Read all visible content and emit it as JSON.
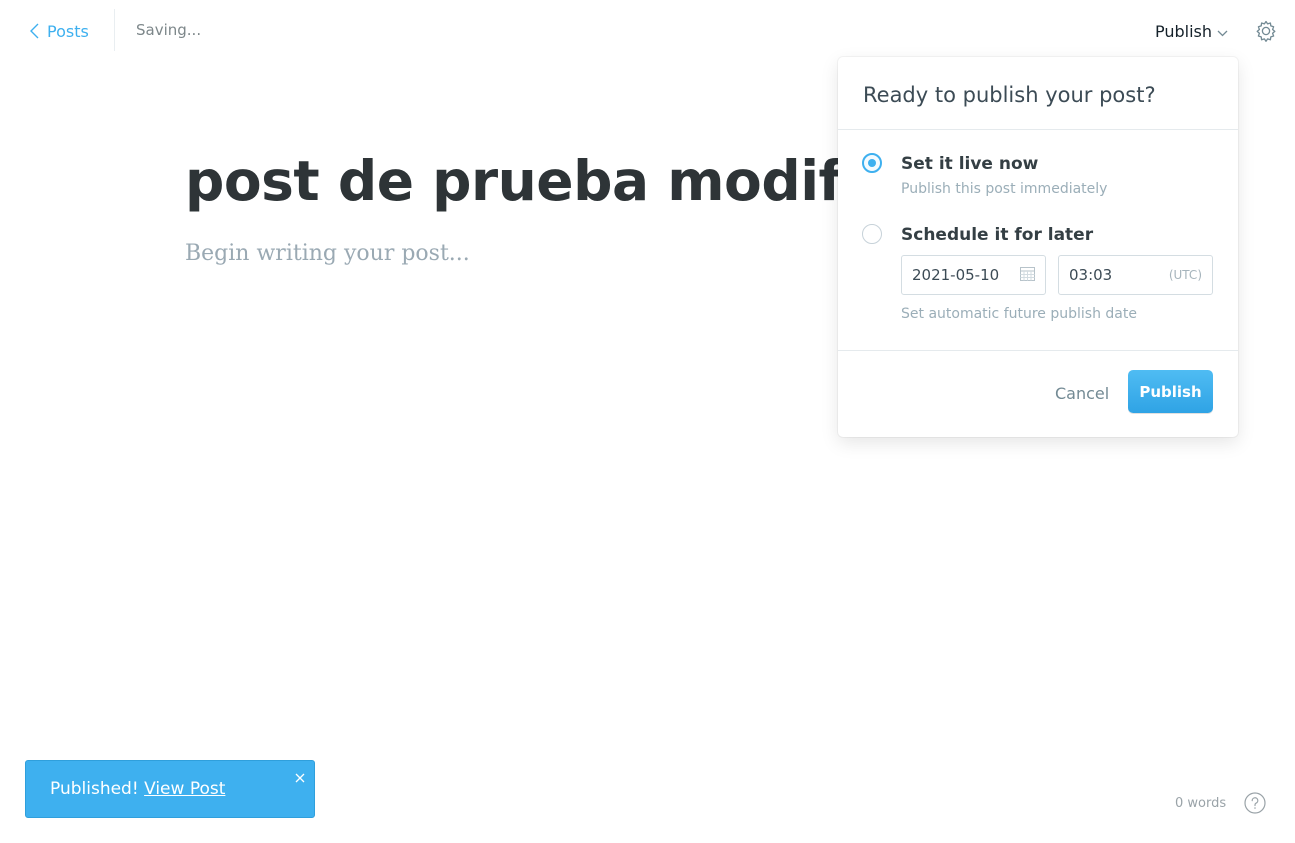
{
  "topbar": {
    "back_label": "Posts",
    "status": "Saving...",
    "publish_menu_label": "Publish"
  },
  "editor": {
    "title": "post de prueba modificado",
    "body_placeholder": "Begin writing your post..."
  },
  "publish_popover": {
    "heading": "Ready to publish your post?",
    "options": [
      {
        "label": "Set it live now",
        "description": "Publish this post immediately",
        "selected": true
      },
      {
        "label": "Schedule it for later",
        "description": "",
        "selected": false
      }
    ],
    "schedule": {
      "date": "2021-05-10",
      "time": "03:03",
      "timezone": "(UTC)",
      "hint": "Set automatic future publish date"
    },
    "cancel_label": "Cancel",
    "publish_label": "Publish"
  },
  "toast": {
    "message": "Published!",
    "link_label": "View Post"
  },
  "footer": {
    "word_count": "0 words"
  },
  "icons": {
    "back": "chevron-left-icon",
    "menu_caret": "chevron-down-icon",
    "settings": "gear-icon",
    "calendar": "calendar-icon",
    "close": "close-icon",
    "help": "help-icon"
  },
  "colors": {
    "accent": "#3eb0ef",
    "title": "#2e3437",
    "muted": "#9baeb8"
  }
}
